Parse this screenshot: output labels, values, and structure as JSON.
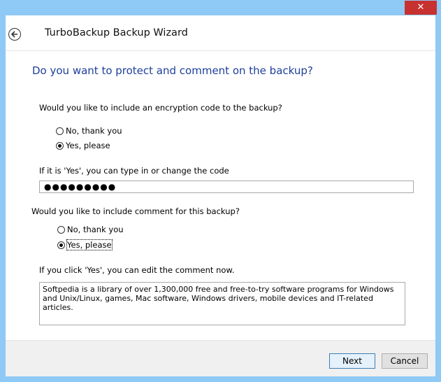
{
  "window": {
    "close_glyph": "✕",
    "frame_color": "#8fc9f5",
    "close_color": "#c7312f"
  },
  "header": {
    "title": "TurboBackup Backup Wizard",
    "back_icon": "back-arrow-icon"
  },
  "main": {
    "heading": "Do you want to protect and comment on the backup?",
    "encryption": {
      "question": "Would you like to include an encryption code to the backup?",
      "options": [
        {
          "label": "No, thank you",
          "selected": false
        },
        {
          "label": "Yes, please",
          "selected": true
        }
      ]
    },
    "code": {
      "label": "If it is 'Yes',  you can type in or change the code",
      "value": "●●●●●●●●●"
    },
    "comment_section": {
      "question": "Would you like to include comment for this backup?",
      "options": [
        {
          "label": "No, thank you",
          "selected": false
        },
        {
          "label": "Yes, please",
          "selected": true
        }
      ],
      "edit_label": "If you click 'Yes', you can edit the comment now.",
      "comment_text": "Softpedia is a library of over 1,300,000 free and free-to-try software programs for Windows and Unix/Linux, games, Mac software, Windows drivers, mobile devices and IT-related articles."
    }
  },
  "footer": {
    "next_label": "Next",
    "cancel_label": "Cancel"
  }
}
